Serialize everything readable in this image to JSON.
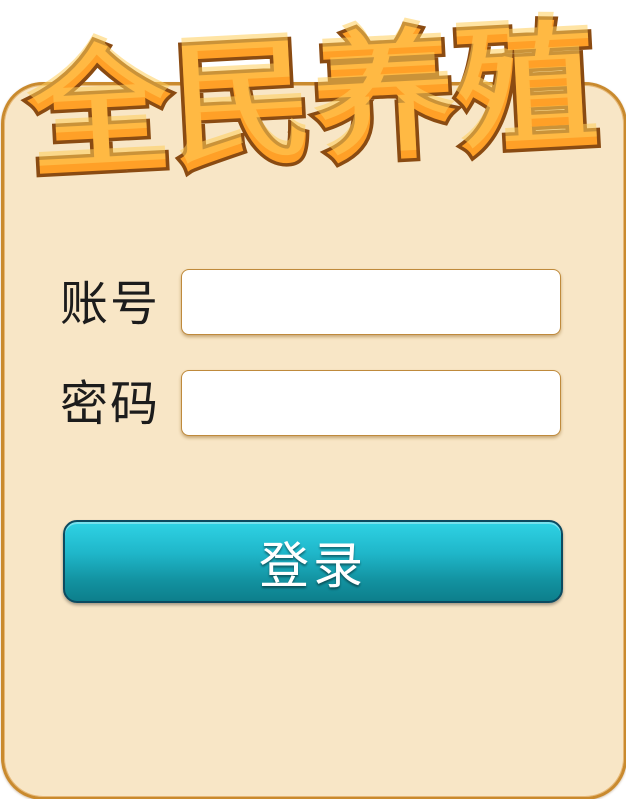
{
  "title": {
    "text": "全民养殖"
  },
  "form": {
    "account_label": "账号",
    "account_value": "",
    "password_label": "密码",
    "password_value": "",
    "login_label": "登录"
  },
  "colors": {
    "panel_background": "#f8e6c6",
    "panel_border": "#c98a2e",
    "title_fill": "#ffa027",
    "title_outline": "#8a4b12",
    "button_top": "#2fd3e5",
    "button_bottom": "#0d7f8c",
    "button_border": "#0c4a60",
    "field_border": "#bf8a3c"
  }
}
